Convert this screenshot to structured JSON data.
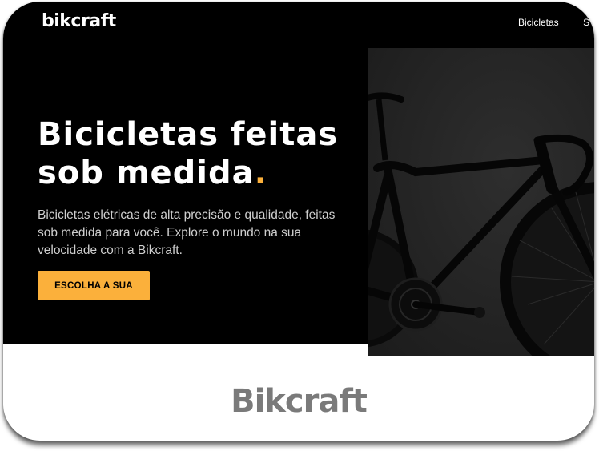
{
  "header": {
    "logo": "bikcraft",
    "nav": [
      "Bicicletas",
      "S"
    ]
  },
  "hero": {
    "title_line1": "Bicicletas feitas",
    "title_line2": "sob medida",
    "title_dot": ".",
    "description": "Bicicletas elétricas de alta precisão e qualidade, feitas sob medida para você. Explore o mundo na sua velocidade com a Bikcraft.",
    "cta_label": "ESCOLHA A SUA",
    "image_icon": "bicycle-photo"
  },
  "brand": {
    "wordmark": "Bikcraft"
  },
  "colors": {
    "accent": "#fbb03b",
    "hero_bg": "#000000",
    "image_bg": "#242424",
    "wordmark": "#7a7a7a"
  }
}
